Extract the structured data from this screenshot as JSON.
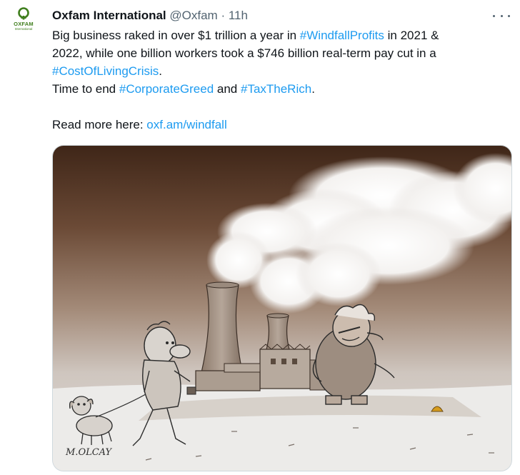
{
  "author": {
    "avatar_wordmark": "OXFAM",
    "avatar_sub": "International",
    "name": "Oxfam International",
    "handle": "@Oxfam",
    "separator": "·",
    "time": "11h"
  },
  "tweet": {
    "line1": [
      "Big business raked in over $1 trillion a year in ",
      "#WindfallProfits",
      " in 2021 &"
    ],
    "line2": "2022, while one billion workers took a $746 billion real-term pay cut in a",
    "line3": "#CostOfLivingCrisis",
    "line3_end": ".",
    "line4": [
      "Time to end ",
      "#CorporateGreed",
      " and ",
      "#TaxTheRich",
      "."
    ],
    "line5": [
      "Read more here: ",
      "oxf.am/windfall"
    ]
  },
  "media": {
    "signature": "M.OLCAY"
  },
  "colors": {
    "link": "#1d9bf0",
    "muted": "#536471",
    "text": "#0f1419",
    "brand_green": "#3f7e1d"
  }
}
